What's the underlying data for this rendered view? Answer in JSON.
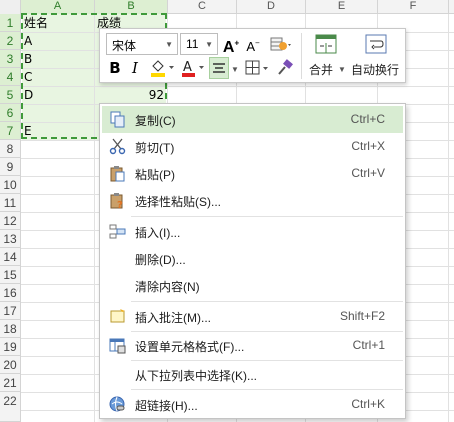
{
  "spreadsheet": {
    "column_headers": [
      "A",
      "B",
      "C",
      "D",
      "E",
      "F"
    ],
    "selected_columns": [
      "A",
      "B"
    ],
    "row_headers": [
      "1",
      "2",
      "3",
      "4",
      "5",
      "6",
      "7",
      "8",
      "9",
      "10",
      "11",
      "12",
      "13",
      "14",
      "15",
      "16",
      "17",
      "18",
      "19",
      "20",
      "21",
      "22"
    ],
    "selected_rows": [
      "1",
      "2",
      "3",
      "4",
      "5",
      "6",
      "7"
    ],
    "cells": {
      "A1": "姓名",
      "B1": "成绩",
      "A2": "A",
      "A3": "B",
      "A4": "C",
      "A5": "D",
      "B5": "92",
      "A7": "E"
    },
    "colors": {
      "selection_fill": "#e8f5e1",
      "selection_border": "#3f9a3a",
      "header_selected": "#ddefd2"
    }
  },
  "mini_toolbar": {
    "font_name": "宋体",
    "font_size": "11",
    "merge_label": "合并",
    "wrap_label": "自动换行",
    "colors": {
      "fill": "#ffd800",
      "font": "#e02020"
    }
  },
  "context_menu": {
    "items": [
      {
        "label": "复制(C)",
        "shortcut": "Ctrl+C",
        "icon": "copy-icon"
      },
      {
        "label": "剪切(T)",
        "shortcut": "Ctrl+X",
        "icon": "scissors-icon"
      },
      {
        "label": "粘贴(P)",
        "shortcut": "Ctrl+V",
        "icon": "paste-icon"
      },
      {
        "label": "选择性粘贴(S)...",
        "shortcut": "",
        "icon": "paste-special-icon"
      },
      {
        "label": "插入(I)...",
        "shortcut": "",
        "icon": "insert-icon"
      },
      {
        "label": "删除(D)...",
        "shortcut": "",
        "icon": ""
      },
      {
        "label": "清除内容(N)",
        "shortcut": "",
        "icon": ""
      },
      {
        "label": "插入批注(M)...",
        "shortcut": "Shift+F2",
        "icon": "comment-icon"
      },
      {
        "label": "设置单元格格式(F)...",
        "shortcut": "Ctrl+1",
        "icon": "format-cells-icon"
      },
      {
        "label": "从下拉列表中选择(K)...",
        "shortcut": "",
        "icon": ""
      },
      {
        "label": "超链接(H)...",
        "shortcut": "Ctrl+K",
        "icon": "hyperlink-icon"
      }
    ],
    "highlight_color": "#d8ecd2"
  }
}
